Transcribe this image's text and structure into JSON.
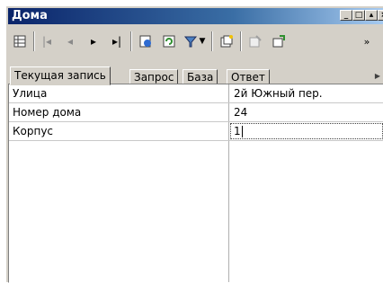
{
  "window": {
    "title": "Дома",
    "controls": {
      "minimize": "_",
      "maximize": "□",
      "restore": "▴",
      "close": "×"
    }
  },
  "toolbar": {
    "buttons": [
      {
        "name": "grid-icon"
      },
      {
        "name": "first-record-icon",
        "glyph": "|◂"
      },
      {
        "name": "prev-record-icon",
        "glyph": "◂"
      },
      {
        "name": "next-record-icon",
        "glyph": "▸"
      },
      {
        "name": "last-record-icon",
        "glyph": "▸|"
      },
      {
        "name": "edit-record-icon"
      },
      {
        "name": "refresh-icon"
      },
      {
        "name": "filter-icon"
      },
      {
        "name": "new-record-icon"
      },
      {
        "name": "delete-record-icon"
      },
      {
        "name": "copy-record-icon"
      }
    ],
    "overflow": "»"
  },
  "tabs": [
    "Текущая запись",
    "Запрос",
    "База",
    "Ответ"
  ],
  "active_tab": "Текущая запись",
  "records": [
    {
      "label": "Улица",
      "value": "2й Южный пер."
    },
    {
      "label": "Номер дома",
      "value": "24"
    },
    {
      "label": "Корпус",
      "value": "1"
    }
  ]
}
